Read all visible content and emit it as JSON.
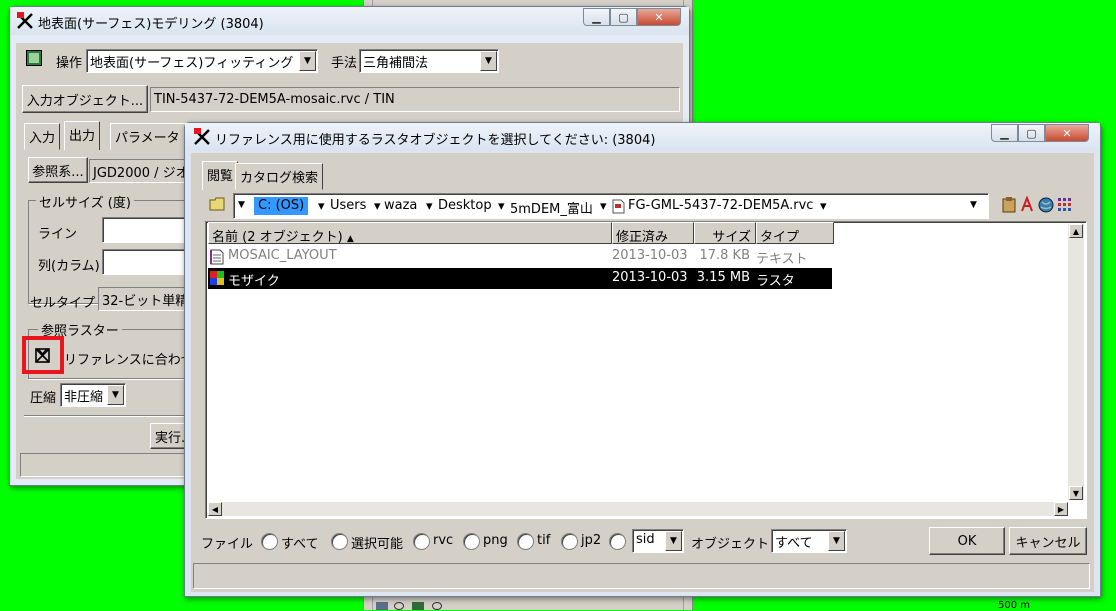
{
  "win1": {
    "title": "地表面(サーフェス)モデリング (3804)",
    "operation_label": "操作",
    "operation_value": "地表面(サーフェス)フィッティング",
    "method_label": "手法",
    "method_value": "三角補間法",
    "input_object_button": "入力オブジェクト...",
    "input_object_value": "TIN-5437-72-DEM5A-mosaic.rvc / TIN",
    "tabs": [
      "入力",
      "出力",
      "パラメータ"
    ],
    "reference_system_button": "参照系...",
    "reference_system_value": "JGD2000 / ジオ",
    "cell_size_group": "セルサイズ (度)",
    "line_label": "ライン",
    "column_label": "列(カラム)",
    "cell_type_label": "セルタイプ",
    "cell_type_value": "32-ビット単精",
    "reference_raster_group": "参照ラスター",
    "match_reference_label": "リファレンスに合わせ",
    "compression_label": "圧縮",
    "compression_value": "非圧縮",
    "run_button": "実行..."
  },
  "win2": {
    "title": "リファレンス用に使用するラスタオブジェクトを選択してください: (3804)",
    "tabs": [
      "閲覧",
      "カタログ検索"
    ],
    "breadcrumb": [
      "C: (OS)",
      "Users",
      "waza",
      "Desktop",
      "5mDEM_富山",
      "FG-GML-5437-72-DEM5A.rvc"
    ],
    "columns": [
      "名前 (2 オブジェクト)",
      "修正済み",
      "サイズ",
      "タイプ"
    ],
    "rows": [
      {
        "name": "MOSAIC_LAYOUT",
        "modified": "2013-10-03",
        "size": "17.8 KB",
        "type": "テキスト"
      },
      {
        "name": "モザイク",
        "modified": "2013-10-03",
        "size": "3.15 MB",
        "type": "ラスタ"
      }
    ],
    "file_label": "ファイル",
    "filter_options": [
      "すべて",
      "選択可能",
      "rvc",
      "png",
      "tif",
      "jp2"
    ],
    "sid_value": "sid",
    "object_label": "オブジェクト",
    "object_value": "すべて",
    "ok_button": "OK",
    "cancel_button": "キャンセル"
  },
  "background": {
    "scale_text": "500 m"
  },
  "colors": {
    "desktop": "#00ff00",
    "highlight": "#3399ff",
    "selected_row": "#000000",
    "annotation_box": "#e8141e"
  }
}
